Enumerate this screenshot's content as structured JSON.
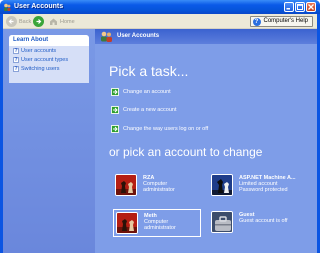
{
  "window": {
    "title": "User Accounts"
  },
  "toolbar": {
    "back_label": "Back",
    "home_label": "Home",
    "help_label": "Computer's Help"
  },
  "sidebar": {
    "learn_header": "Learn About",
    "items": [
      {
        "label": "User accounts"
      },
      {
        "label": "User account types"
      },
      {
        "label": "Switching users"
      }
    ]
  },
  "main": {
    "header_title": "User Accounts",
    "pick_task": "Pick a task...",
    "tasks": [
      {
        "label": "Change an account"
      },
      {
        "label": "Create a new account"
      },
      {
        "label": "Change the way users log on or off"
      }
    ],
    "pick_account": "or pick an account to change",
    "accounts": [
      {
        "name": "RZA",
        "line1": "Computer",
        "line2": "administrator",
        "picture": "chess-pieces"
      },
      {
        "name": "ASP.NET Machine A...",
        "line1": "Limited account",
        "line2": "Password protected",
        "picture": "chess-pieces"
      },
      {
        "name": "Meth",
        "line1": "Computer",
        "line2": "administrator",
        "picture": "chess-pieces"
      },
      {
        "name": "Guest",
        "line1": "Guest account is off",
        "line2": "",
        "picture": "briefcase"
      }
    ]
  },
  "colors": {
    "titlebar": "#0a5ae8",
    "sidebar": "#7a99e6",
    "main_bg": "#7e9de8",
    "task_arrow": "#2f9f2f"
  }
}
